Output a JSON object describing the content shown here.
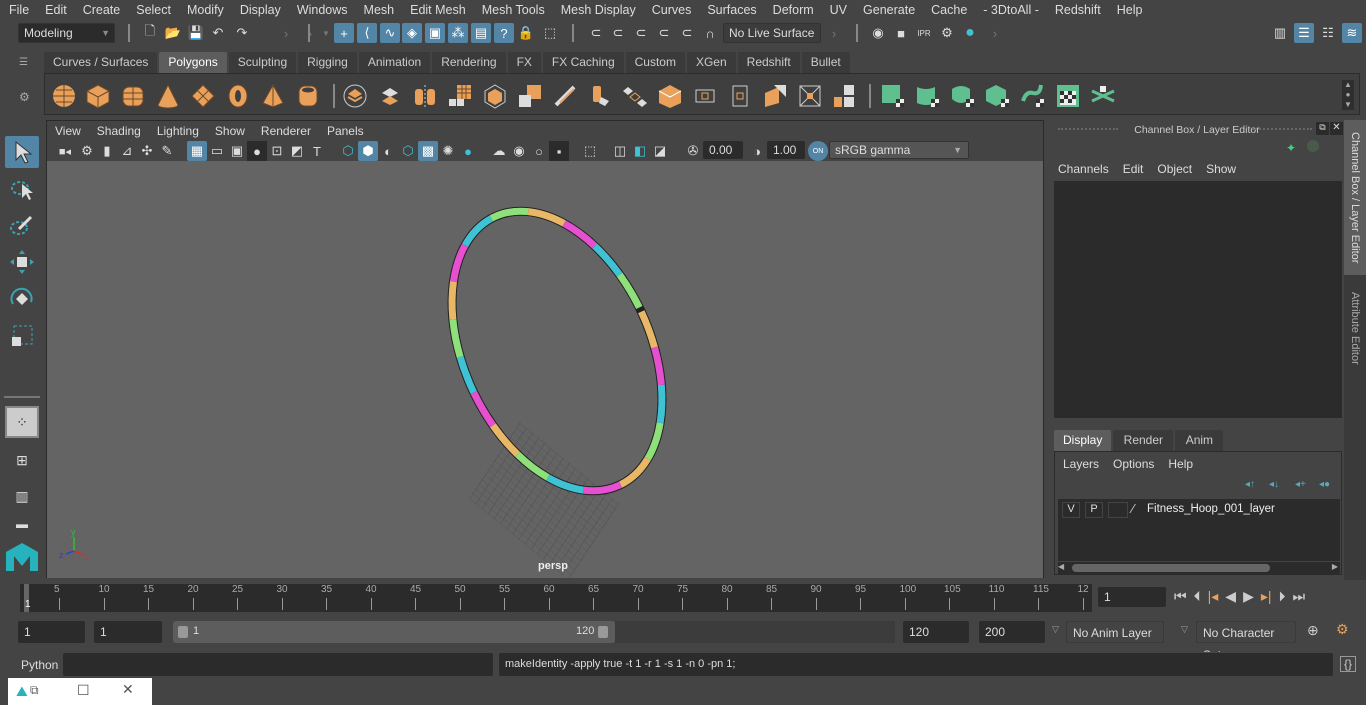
{
  "menubar": {
    "items": [
      "File",
      "Edit",
      "Create",
      "Select",
      "Modify",
      "Display",
      "Windows",
      "Mesh",
      "Edit Mesh",
      "Mesh Tools",
      "Mesh Display",
      "Curves",
      "Surfaces",
      "Deform",
      "UV",
      "Generate",
      "Cache",
      "- 3DtoAll -",
      "Redshift",
      "Help"
    ]
  },
  "status_line": {
    "workspace": "Modeling",
    "live_surface": "No Live Surface"
  },
  "shelf_tabs": [
    "Curves / Surfaces",
    "Polygons",
    "Sculpting",
    "Rigging",
    "Animation",
    "Rendering",
    "FX",
    "FX Caching",
    "Custom",
    "XGen",
    "Redshift",
    "Bullet"
  ],
  "shelf_active_tab": "Polygons",
  "shelf_icons": {
    "orange": [
      "poly-sphere",
      "poly-cube",
      "poly-cylinder",
      "poly-cone",
      "poly-plane",
      "poly-torus",
      "poly-pyramid",
      "poly-pipe"
    ],
    "tools": [
      "combine",
      "separate",
      "mirror",
      "smooth",
      "extract",
      "booleans",
      "bevel",
      "bridge",
      "extrude",
      "append-to-polygon",
      "insert-edge-loop",
      "multi-cut",
      "target-weld",
      "merge",
      "quadrangulate"
    ],
    "green": [
      "planar-uv",
      "cylindrical-uv",
      "spherical-uv",
      "automatic-uv",
      "unfold-uv",
      "uv-editor",
      "cut-sew-uv"
    ]
  },
  "viewport": {
    "menu": [
      "View",
      "Shading",
      "Lighting",
      "Show",
      "Renderer",
      "Panels"
    ],
    "exposure": "0.00",
    "gamma": "1.00",
    "color_space": "sRGB gamma",
    "color_mgmt_badge": "ON",
    "camera_label": "persp",
    "axis": {
      "x": "x",
      "y": "y",
      "z": "z"
    },
    "hoop_colors": [
      "#e9b866",
      "#e54fd0",
      "#3fc2d3",
      "#8ee07a"
    ]
  },
  "channel_box": {
    "title": "Channel Box / Layer Editor",
    "menu": [
      "Channels",
      "Edit",
      "Object",
      "Show"
    ]
  },
  "layer_editor": {
    "tabs": [
      "Display",
      "Render",
      "Anim"
    ],
    "active_tab": "Display",
    "menu": [
      "Layers",
      "Options",
      "Help"
    ],
    "layers": [
      {
        "v": "V",
        "p": "P",
        "name": "Fitness_Hoop_001_layer"
      }
    ]
  },
  "side_tabs": [
    "Channel Box / Layer Editor",
    "Attribute Editor"
  ],
  "timeline": {
    "ticks": [
      "5",
      "10",
      "15",
      "20",
      "25",
      "30",
      "35",
      "40",
      "45",
      "50",
      "55",
      "60",
      "65",
      "70",
      "75",
      "80",
      "85",
      "90",
      "95",
      "100",
      "105",
      "110",
      "115",
      "12"
    ],
    "current_marker": "1",
    "current_frame": "1"
  },
  "range": {
    "start": "1",
    "playback_start": "1",
    "slider_min": "1",
    "slider_max": "120",
    "playback_end": "120",
    "end": "200",
    "anim_layer": "No Anim Layer",
    "character_set": "No Character Set"
  },
  "command_line": {
    "language": "Python",
    "input": "",
    "result": "makeIdentity -apply true -t 1 -r 1 -s 1 -n 0 -pn 1;"
  },
  "colors": {
    "accent_blue": "#5285a6",
    "shelf_orange": "#e8a05a",
    "shelf_green": "#5fbf8f",
    "maya_teal": "#27b3bd"
  }
}
